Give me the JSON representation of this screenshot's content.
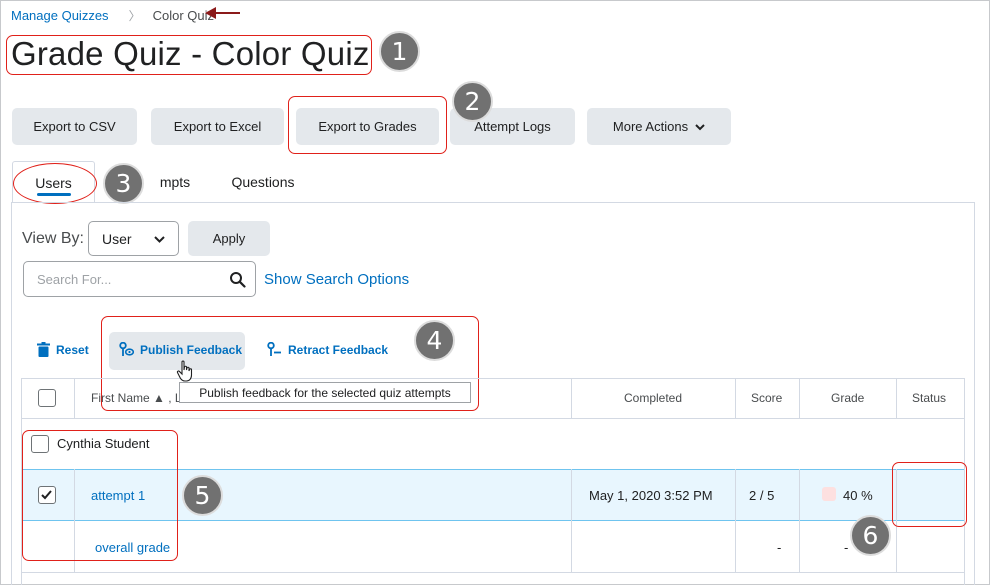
{
  "breadcrumb": {
    "parent": "Manage Quizzes",
    "separator": "〉",
    "current": "Color Quiz"
  },
  "page_title": "Grade Quiz - Color Quiz",
  "toolbar": {
    "export_csv": "Export to CSV",
    "export_excel": "Export to Excel",
    "export_grades": "Export to Grades",
    "attempt_logs": "Attempt Logs",
    "more_actions": "More Actions"
  },
  "tabs": [
    {
      "label": "Users",
      "active": true
    },
    {
      "label": "mpts",
      "active": false
    },
    {
      "label": "Questions",
      "active": false
    }
  ],
  "filters": {
    "view_by_label": "View By:",
    "view_by_value": "User",
    "apply_label": "Apply",
    "search_placeholder": "Search For...",
    "show_search_options": "Show Search Options"
  },
  "actions": {
    "reset": "Reset",
    "publish_feedback": "Publish Feedback",
    "retract_feedback": "Retract Feedback",
    "tooltip": "Publish feedback for the selected quiz attempts"
  },
  "table": {
    "headers": {
      "first_name": "First Name ▲ , L",
      "completed": "Completed",
      "score": "Score",
      "grade": "Grade",
      "status": "Status"
    },
    "user_row": {
      "name": "Cynthia Student"
    },
    "attempt_row": {
      "label": "attempt 1",
      "completed": "May 1, 2020 3:52 PM",
      "score": "2 / 5",
      "grade": "40 %",
      "status": ""
    },
    "overall_row": {
      "label": "overall grade",
      "score": "-",
      "grade": "-"
    }
  },
  "callouts": [
    "1",
    "2",
    "3",
    "4",
    "5",
    "6"
  ],
  "colors": {
    "accent": "#006fbf",
    "callout": "#e0211a",
    "badge": "#717171",
    "selected_row": "#e8f6fe",
    "arrow": "#8b1a1a"
  }
}
